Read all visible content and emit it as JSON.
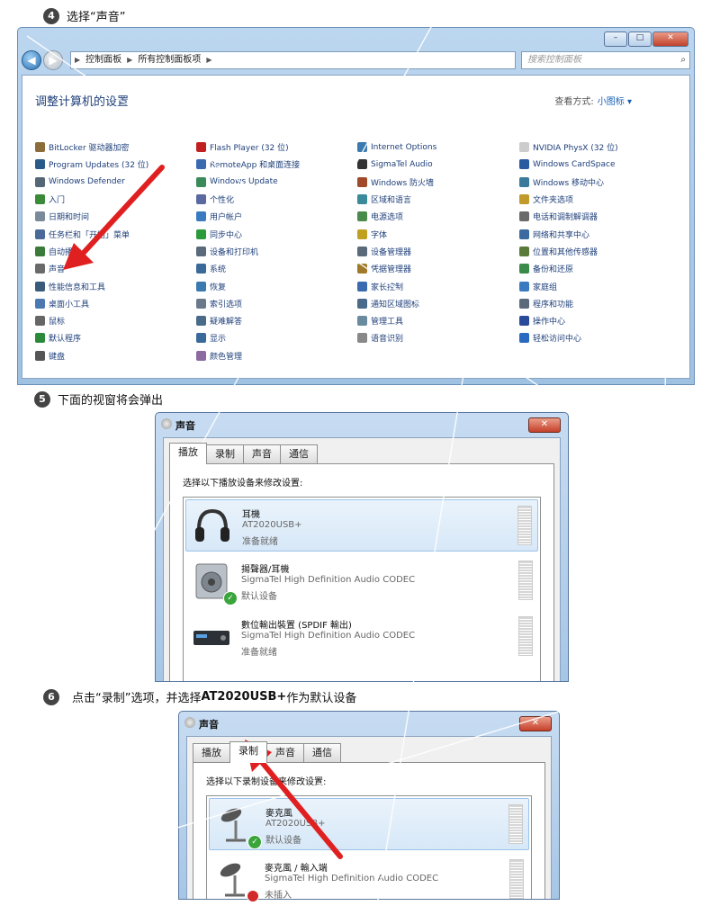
{
  "steps": [
    {
      "num": "4",
      "text": "选择“声音”"
    },
    {
      "num": "5",
      "text": "下面的视窗将会弹出"
    },
    {
      "num": "6",
      "text_pre": "点击“录制”选项，并选择",
      "text_bold": "AT2020USB+",
      "text_post": "作为默认设备"
    }
  ],
  "control_panel": {
    "window_buttons": {
      "minimize": "–",
      "maximize": "□",
      "close": "✕"
    },
    "nav": {
      "back": "◀",
      "forward": "▶"
    },
    "breadcrumb": [
      "控制面板",
      "所有控制面板项"
    ],
    "search_placeholder": "搜索控制面板",
    "heading": "调整计算机的设置",
    "view_by_label": "查看方式:",
    "view_by_value": "小图标 ▾",
    "columns": [
      [
        {
          "label": "BitLocker 驱动器加密",
          "color": "#8a6d3b"
        },
        {
          "label": "Program Updates (32 位)",
          "color": "#2a5a8a"
        },
        {
          "label": "Windows Defender",
          "color": "#556677"
        },
        {
          "label": "入门",
          "color": "#3a8a3a"
        },
        {
          "label": "日期和时间",
          "color": "#7a8a9a"
        },
        {
          "label": "任务栏和「开始」菜单",
          "color": "#4a6a9a"
        },
        {
          "label": "自动播放",
          "color": "#3a7a3a"
        },
        {
          "label": "声音",
          "color": "#6a6a6a"
        },
        {
          "label": "性能信息和工具",
          "color": "#3a5a7a"
        },
        {
          "label": "桌面小工具",
          "color": "#4a7ab0"
        },
        {
          "label": "鼠标",
          "color": "#666666"
        },
        {
          "label": "默认程序",
          "color": "#2a8a3a"
        },
        {
          "label": "键盘",
          "color": "#555555"
        }
      ],
      [
        {
          "label": "Flash Player (32 位)",
          "color": "#c02020"
        },
        {
          "label": "RemoteApp 和桌面连接",
          "color": "#3a6ab0"
        },
        {
          "label": "Windows Update",
          "color": "#3a8a5a"
        },
        {
          "label": "个性化",
          "color": "#5a6aa0"
        },
        {
          "label": "用户帐户",
          "color": "#3a7ac0"
        },
        {
          "label": "同步中心",
          "color": "#2a9a3a"
        },
        {
          "label": "设备和打印机",
          "color": "#5a6a7a"
        },
        {
          "label": "系统",
          "color": "#3a6a9a"
        },
        {
          "label": "恢复",
          "color": "#3a7ab0"
        },
        {
          "label": "索引选项",
          "color": "#6a7a8a"
        },
        {
          "label": "疑难解答",
          "color": "#4a6a8a"
        },
        {
          "label": "显示",
          "color": "#3a6a9a"
        },
        {
          "label": "颜色管理",
          "color": "#8a6aa0"
        }
      ],
      [
        {
          "label": "Internet Options",
          "color": "#3a7ab0"
        },
        {
          "label": "SigmaTel Audio",
          "color": "#333333"
        },
        {
          "label": "Windows 防火墙",
          "color": "#a04a2a"
        },
        {
          "label": "区域和语言",
          "color": "#3a8a9a"
        },
        {
          "label": "电源选项",
          "color": "#4a8a4a"
        },
        {
          "label": "字体",
          "color": "#c0a020"
        },
        {
          "label": "设备管理器",
          "color": "#5a6a7a"
        },
        {
          "label": "凭据管理器",
          "color": "#a07a2a"
        },
        {
          "label": "家长控制",
          "color": "#3a6ab0"
        },
        {
          "label": "通知区域图标",
          "color": "#4a6a8a"
        },
        {
          "label": "管理工具",
          "color": "#6a8aa0"
        },
        {
          "label": "语音识别",
          "color": "#888888"
        }
      ],
      [
        {
          "label": "NVIDIA PhysX (32 位)",
          "color": "#cccccc"
        },
        {
          "label": "Windows CardSpace",
          "color": "#2a5aa0"
        },
        {
          "label": "Windows 移动中心",
          "color": "#3a7a9a"
        },
        {
          "label": "文件夹选项",
          "color": "#c09a2a"
        },
        {
          "label": "电话和调制解调器",
          "color": "#6a6a6a"
        },
        {
          "label": "网络和共享中心",
          "color": "#3a6aa0"
        },
        {
          "label": "位置和其他传感器",
          "color": "#5a7a3a"
        },
        {
          "label": "备份和还原",
          "color": "#3a8a4a"
        },
        {
          "label": "家庭组",
          "color": "#3a7ac0"
        },
        {
          "label": "程序和功能",
          "color": "#5a6a7a"
        },
        {
          "label": "操作中心",
          "color": "#2a4a9a"
        },
        {
          "label": "轻松访问中心",
          "color": "#2a6ac0"
        }
      ]
    ]
  },
  "dialog1": {
    "title": "声音",
    "close": "✕",
    "tabs": [
      "播放",
      "录制",
      "声音",
      "通信"
    ],
    "active_tab": 0,
    "prompt": "选择以下播放设备来修改设置:",
    "devices": [
      {
        "name": "耳機",
        "line1": "AT2020USB+",
        "line2": "准备就绪",
        "selected": true,
        "icon": "headphones-icon"
      },
      {
        "name": "揚聲器/耳機",
        "line1": "SigmaTel High Definition Audio CODEC",
        "line2": "默认设备",
        "selected": false,
        "icon": "speaker-icon"
      },
      {
        "name": "數位輸出裝置 (SPDIF 輸出)",
        "line1": "SigmaTel High Definition Audio CODEC",
        "line2": "准备就绪",
        "selected": false,
        "icon": "spdif-device-icon"
      }
    ]
  },
  "dialog2": {
    "title": "声音",
    "close": "✕",
    "tabs": [
      "播放",
      "录制",
      "声音",
      "通信"
    ],
    "active_tab": 1,
    "prompt": "选择以下录制设备来修改设置:",
    "devices": [
      {
        "name": "麥克風",
        "line1": "AT2020USB+",
        "line2": "默认设备",
        "selected": true,
        "icon": "microphone-icon"
      },
      {
        "name": "麥克風 / 輸入端",
        "line1": "SigmaTel High Definition Audio CODEC",
        "line2": "未插入",
        "selected": false,
        "icon": "microphone-icon"
      }
    ]
  },
  "colors": {
    "arrow": "#e02020",
    "link": "#1e3f7a",
    "titlebar": "#a6c6e6"
  }
}
